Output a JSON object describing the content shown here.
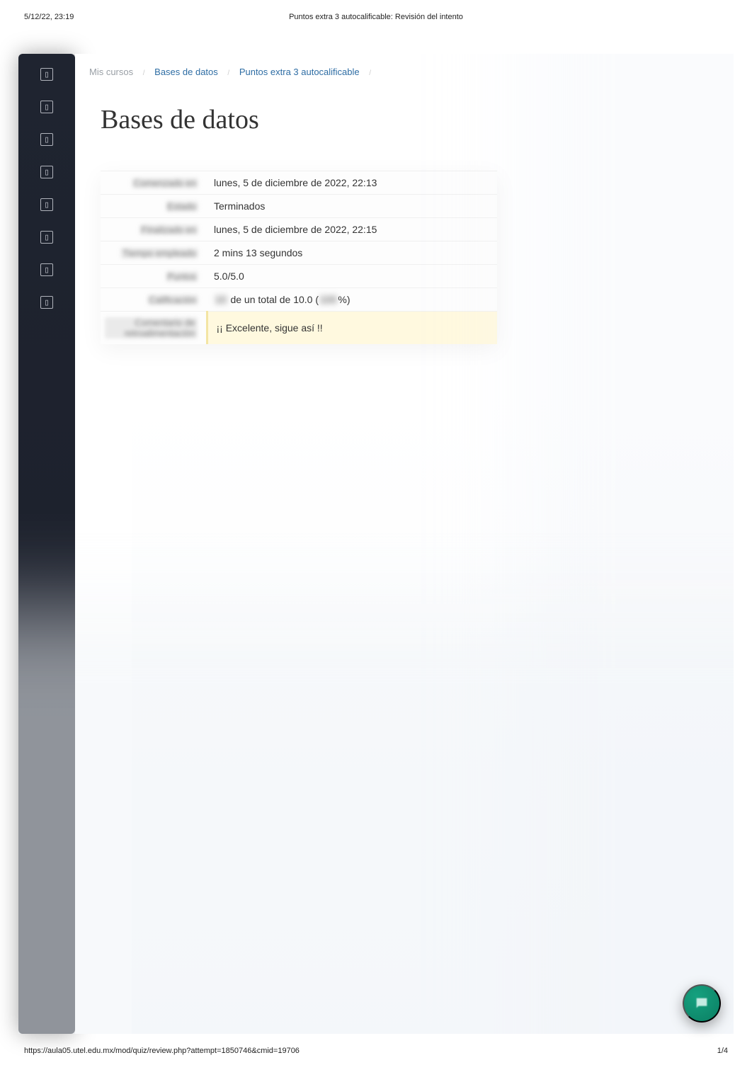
{
  "print_header": {
    "left": "5/12/22, 23:19",
    "center": "Puntos extra 3 autocalificable: Revisión del intento"
  },
  "breadcrumb": {
    "item1": "Mis cursos",
    "item2": "Bases de datos",
    "item3": "Puntos extra 3 autocalificable"
  },
  "page_title": "Bases de datos",
  "summary": {
    "rows": {
      "started": {
        "label": "Comenzado en",
        "value": "lunes, 5 de diciembre de 2022, 22:13"
      },
      "state": {
        "label": "Estado",
        "value": "Terminados"
      },
      "finished": {
        "label": "Finalizado en",
        "value": "lunes, 5 de diciembre de 2022, 22:15"
      },
      "time": {
        "label": "Tiempo empleado",
        "value": "2 mins 13 segundos"
      },
      "points": {
        "label": "Puntos",
        "value": "5.0/5.0"
      },
      "grade": {
        "label": "Calificación",
        "prefix_blur": "10",
        "mid": " de un total de 10.0 (",
        "pct_blur": "100",
        "suffix": "%)"
      },
      "feedback": {
        "label": "Comentario de retroalimentación",
        "value": "¡¡ Excelente, sigue así !!"
      }
    }
  },
  "footer": {
    "left": "https://aula05.utel.edu.mx/mod/quiz/review.php?attempt=1850746&cmid=19706",
    "right": "1/4"
  }
}
